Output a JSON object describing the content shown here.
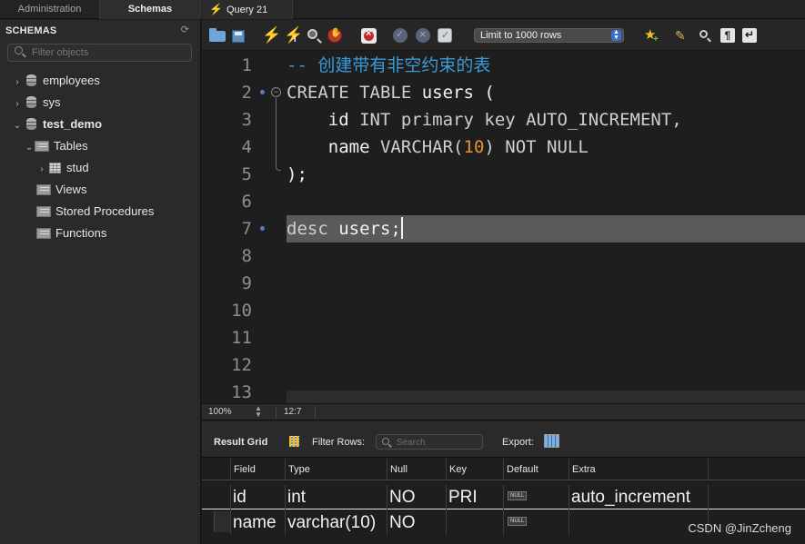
{
  "tabs": {
    "administration": "Administration",
    "schemas": "Schemas",
    "query": "Query 21"
  },
  "sidebar": {
    "header": "SCHEMAS",
    "search_placeholder": "Filter objects",
    "schemas": [
      {
        "name": "employees",
        "expanded": false
      },
      {
        "name": "sys",
        "expanded": false
      },
      {
        "name": "test_demo",
        "expanded": true
      }
    ],
    "test_demo_children": {
      "tables": "Tables",
      "table_items": [
        "stud"
      ],
      "views": "Views",
      "stored_procedures": "Stored Procedures",
      "functions": "Functions"
    }
  },
  "toolbar": {
    "limit_select": "Limit to 1000 rows"
  },
  "editor": {
    "line_numbers": [
      "1",
      "2",
      "3",
      "4",
      "5",
      "6",
      "7",
      "8",
      "9",
      "10",
      "11",
      "12",
      "13"
    ],
    "lines": {
      "l1_comment": "-- 创建带有非空约束的表",
      "l2_kw": "CREATE TABLE",
      "l2_ident": "users",
      "l2_paren": "(",
      "l3_col": "id",
      "l3_rest": "INT primary key AUTO_INCREMENT,",
      "l4_col": "name",
      "l4_type": "VARCHAR(",
      "l4_num": "10",
      "l4_rest": ") NOT NULL",
      "l5": ");",
      "l7_kw": "desc",
      "l7_rest": "users;"
    }
  },
  "status": {
    "zoom": "100%",
    "cursor_pos": "12:7"
  },
  "result_toolbar": {
    "result_grid": "Result Grid",
    "filter_rows": "Filter Rows:",
    "search_placeholder": "Search",
    "export": "Export:"
  },
  "result_grid": {
    "columns": [
      "Field",
      "Type",
      "Null",
      "Key",
      "Default",
      "Extra"
    ],
    "rows": [
      [
        "id",
        "int",
        "NO",
        "PRI",
        "NULL",
        "auto_increment"
      ],
      [
        "name",
        "varchar(10)",
        "NO",
        "",
        "NULL",
        ""
      ]
    ]
  },
  "watermark": "CSDN @JinZcheng"
}
